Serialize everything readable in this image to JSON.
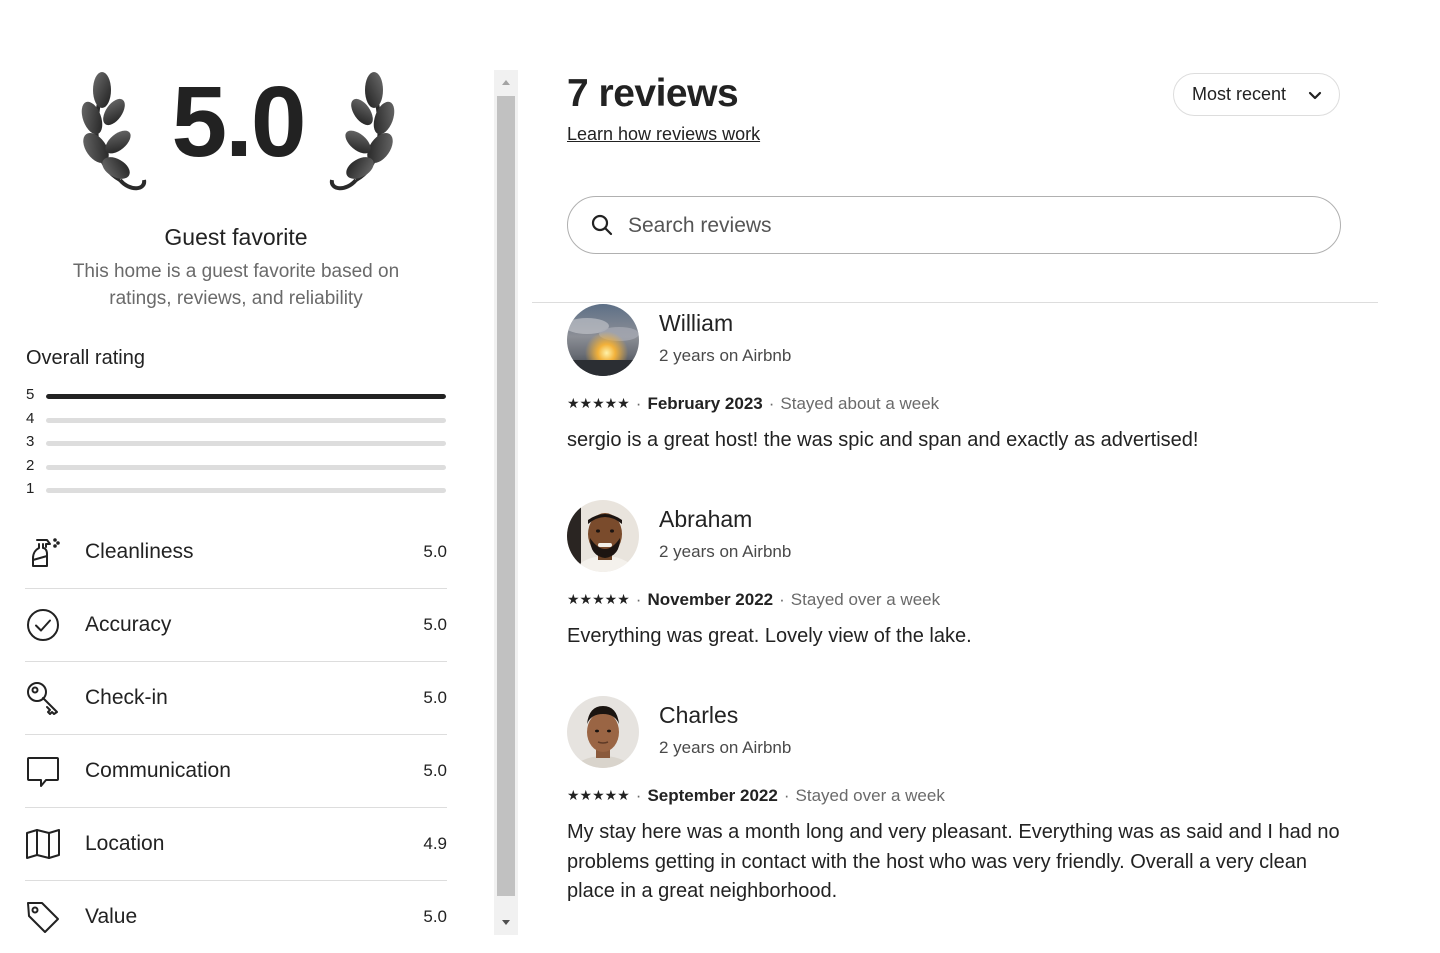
{
  "rating_summary": {
    "score": "5.0",
    "badge_title": "Guest favorite",
    "badge_subtitle": "This home is a guest favorite based on ratings, reviews, and reliability"
  },
  "overall_rating": {
    "label": "Overall rating",
    "bars": [
      {
        "stars": "5",
        "fraction": 1.0
      },
      {
        "stars": "4",
        "fraction": 0.0
      },
      {
        "stars": "3",
        "fraction": 0.0
      },
      {
        "stars": "2",
        "fraction": 0.0
      },
      {
        "stars": "1",
        "fraction": 0.0
      }
    ]
  },
  "categories": [
    {
      "name": "Cleanliness",
      "value": "5.0",
      "icon": "spray-bottle-icon"
    },
    {
      "name": "Accuracy",
      "value": "5.0",
      "icon": "check-circle-icon"
    },
    {
      "name": "Check-in",
      "value": "5.0",
      "icon": "key-icon"
    },
    {
      "name": "Communication",
      "value": "5.0",
      "icon": "speech-bubble-icon"
    },
    {
      "name": "Location",
      "value": "4.9",
      "icon": "map-icon"
    },
    {
      "name": "Value",
      "value": "5.0",
      "icon": "price-tag-icon"
    }
  ],
  "reviews_header": {
    "title": "7 reviews",
    "learn_link": "Learn how reviews work",
    "sort_label": "Most recent"
  },
  "search": {
    "placeholder": "Search reviews"
  },
  "reviews": [
    {
      "name": "William",
      "tenure": "2 years on Airbnb",
      "stars": "★★★★★",
      "date": "February 2023",
      "stay": "Stayed about a week",
      "text": "sergio is a great host! the was spic and span and exactly as advertised!"
    },
    {
      "name": "Abraham",
      "tenure": "2 years on Airbnb",
      "stars": "★★★★★",
      "date": "November 2022",
      "stay": "Stayed over a week",
      "text": "Everything was great. Lovely view of the lake."
    },
    {
      "name": "Charles",
      "tenure": "2 years on Airbnb",
      "stars": "★★★★★",
      "date": "September 2022",
      "stay": "Stayed over a week",
      "text": "My stay here was a month long and very pleasant. Everything was as said and I had no problems getting in contact with the host who was very friendly. Overall a very clean place in a great neighborhood."
    }
  ],
  "separator": "·"
}
